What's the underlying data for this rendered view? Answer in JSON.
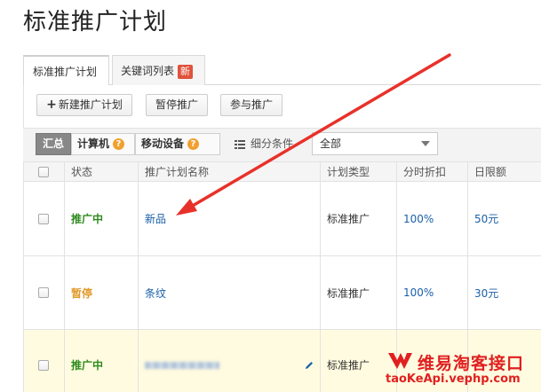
{
  "page": {
    "title": "标准推广计划"
  },
  "tabs": [
    {
      "label": "标准推广计划",
      "active": true
    },
    {
      "label": "关键词列表",
      "badge": "新",
      "active": false
    }
  ],
  "toolbar": {
    "new_plan_label": "新建推广计划",
    "pause_label": "暂停推广",
    "join_label": "参与推广"
  },
  "filter": {
    "summary_label": "汇总",
    "pc_label": "计算机",
    "mobile_label": "移动设备",
    "subfilter_label": "细分条件",
    "select_value": "全部"
  },
  "table": {
    "headers": [
      "状态",
      "推广计划名称",
      "计划类型",
      "分时折扣",
      "日限额"
    ],
    "rows": [
      {
        "status": "推广中",
        "status_kind": "on",
        "name": "新品",
        "type": "标准推广",
        "discount": "100%",
        "budget": "50元"
      },
      {
        "status": "暂停",
        "status_kind": "pause",
        "name": "条纹",
        "type": "标准推广",
        "discount": "100%",
        "budget": "30元"
      },
      {
        "status": "推广中",
        "status_kind": "on",
        "name": "",
        "type": "标准推广",
        "discount": "",
        "budget": ""
      }
    ]
  },
  "watermark": {
    "name": "维易淘客接口",
    "url": "taoKeApi.vephp.com"
  },
  "colors": {
    "status_on": "#2e8b1e",
    "status_pause": "#e09a2a",
    "link": "#1a5fa8",
    "badge": "#e0523c",
    "arrow": "#e8312a",
    "highlight_row": "#fffbe0"
  }
}
